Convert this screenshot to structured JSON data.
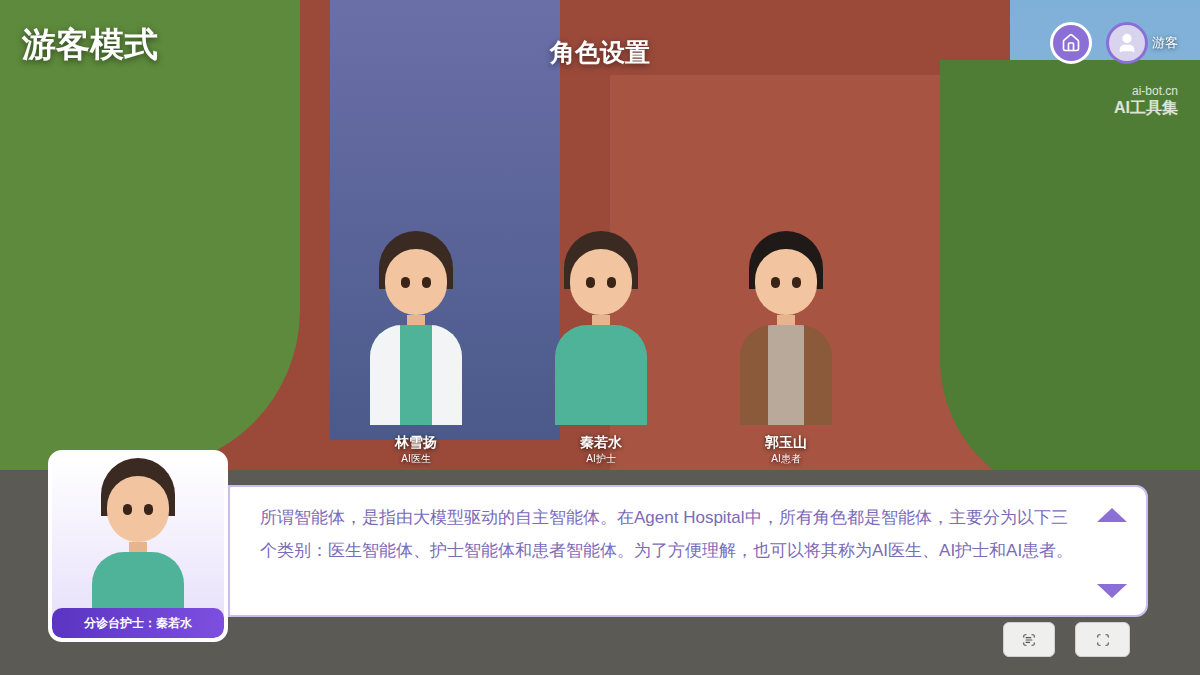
{
  "header": {
    "mode_title": "游客模式",
    "page_title": "角色设置",
    "user": {
      "name": "游客"
    }
  },
  "watermark": {
    "domain": "ai-bot.cn",
    "name": "AI工具集"
  },
  "characters": [
    {
      "name": "林雪扬",
      "role": "AI医生",
      "kind": "doctor"
    },
    {
      "name": "秦若水",
      "role": "AI护士",
      "kind": "nurse"
    },
    {
      "name": "郭玉山",
      "role": "AI患者",
      "kind": "patient"
    }
  ],
  "dialog": {
    "speaker": "分诊台护士：秦若水",
    "text": "所谓智能体，是指由大模型驱动的自主智能体。在Agent Hospital中，所有角色都是智能体，主要分为以下三个类别：医生智能体、护士智能体和患者智能体。为了方便理解，也可以将其称为AI医生、AI护士和AI患者。"
  }
}
